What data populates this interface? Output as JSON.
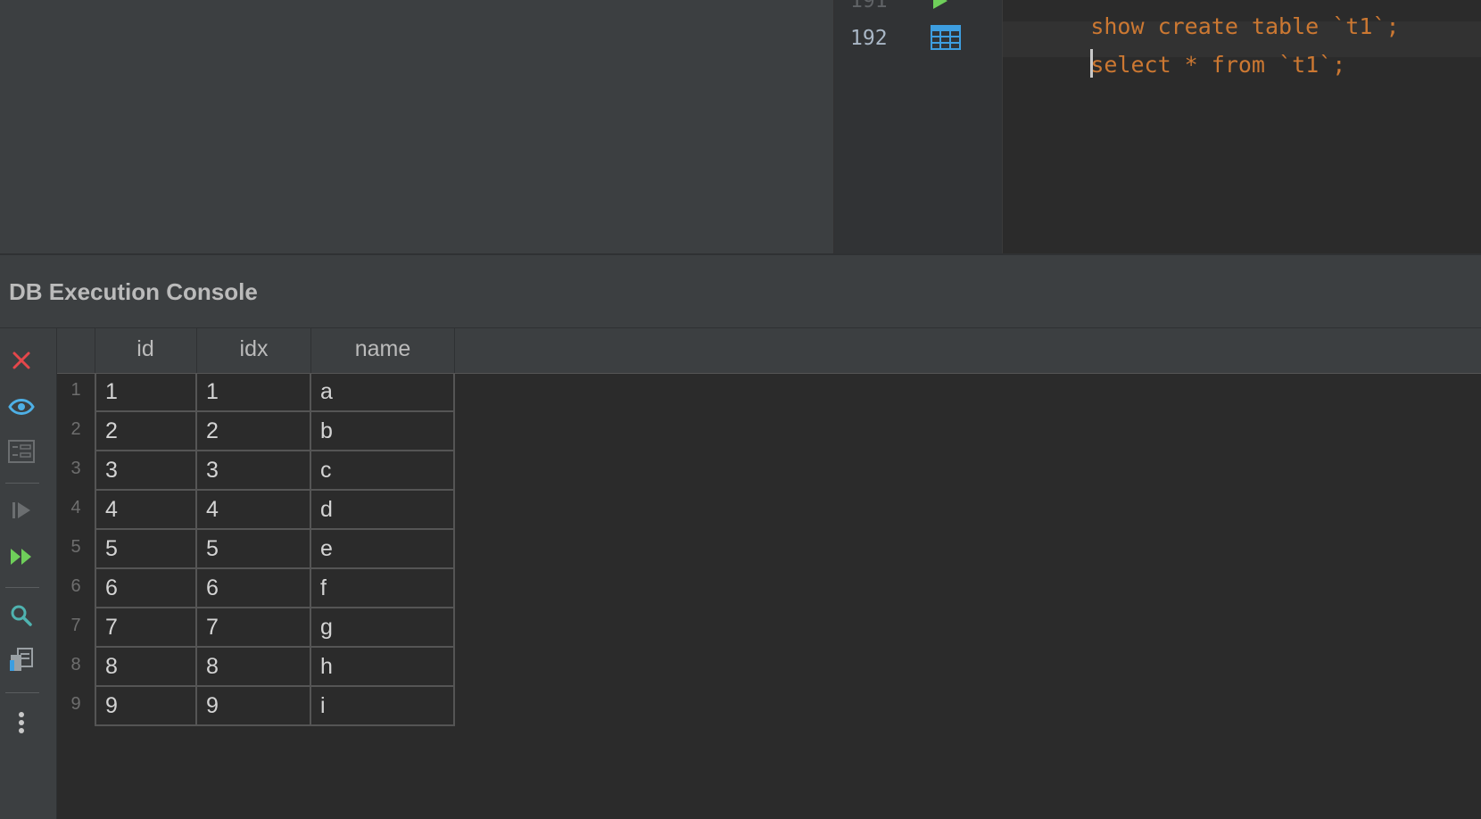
{
  "editor": {
    "lines": [
      {
        "num": "191",
        "code": "show create table `t1`;"
      },
      {
        "num": "192",
        "code": "select * from `t1`;"
      }
    ]
  },
  "console": {
    "title": "DB Execution Console"
  },
  "toolbar": {
    "icons": [
      "close-icon",
      "eye-icon",
      "form-view-icon",
      "step-icon",
      "run-all-icon",
      "search-icon",
      "copy-icon",
      "more-icon"
    ]
  },
  "grid": {
    "columns": [
      "id",
      "idx",
      "name"
    ],
    "rows": [
      {
        "n": "1",
        "id": "1",
        "idx": "1",
        "name": "a"
      },
      {
        "n": "2",
        "id": "2",
        "idx": "2",
        "name": "b"
      },
      {
        "n": "3",
        "id": "3",
        "idx": "3",
        "name": "c"
      },
      {
        "n": "4",
        "id": "4",
        "idx": "4",
        "name": "d"
      },
      {
        "n": "5",
        "id": "5",
        "idx": "5",
        "name": "e"
      },
      {
        "n": "6",
        "id": "6",
        "idx": "6",
        "name": "f"
      },
      {
        "n": "7",
        "id": "7",
        "idx": "7",
        "name": "g"
      },
      {
        "n": "8",
        "id": "8",
        "idx": "8",
        "name": "h"
      },
      {
        "n": "9",
        "id": "9",
        "idx": "9",
        "name": "i"
      }
    ]
  },
  "colors": {
    "keyword": "#cc7832",
    "close": "#e5474b",
    "accent": "#4eb0e6",
    "run": "#6fcf5a"
  }
}
